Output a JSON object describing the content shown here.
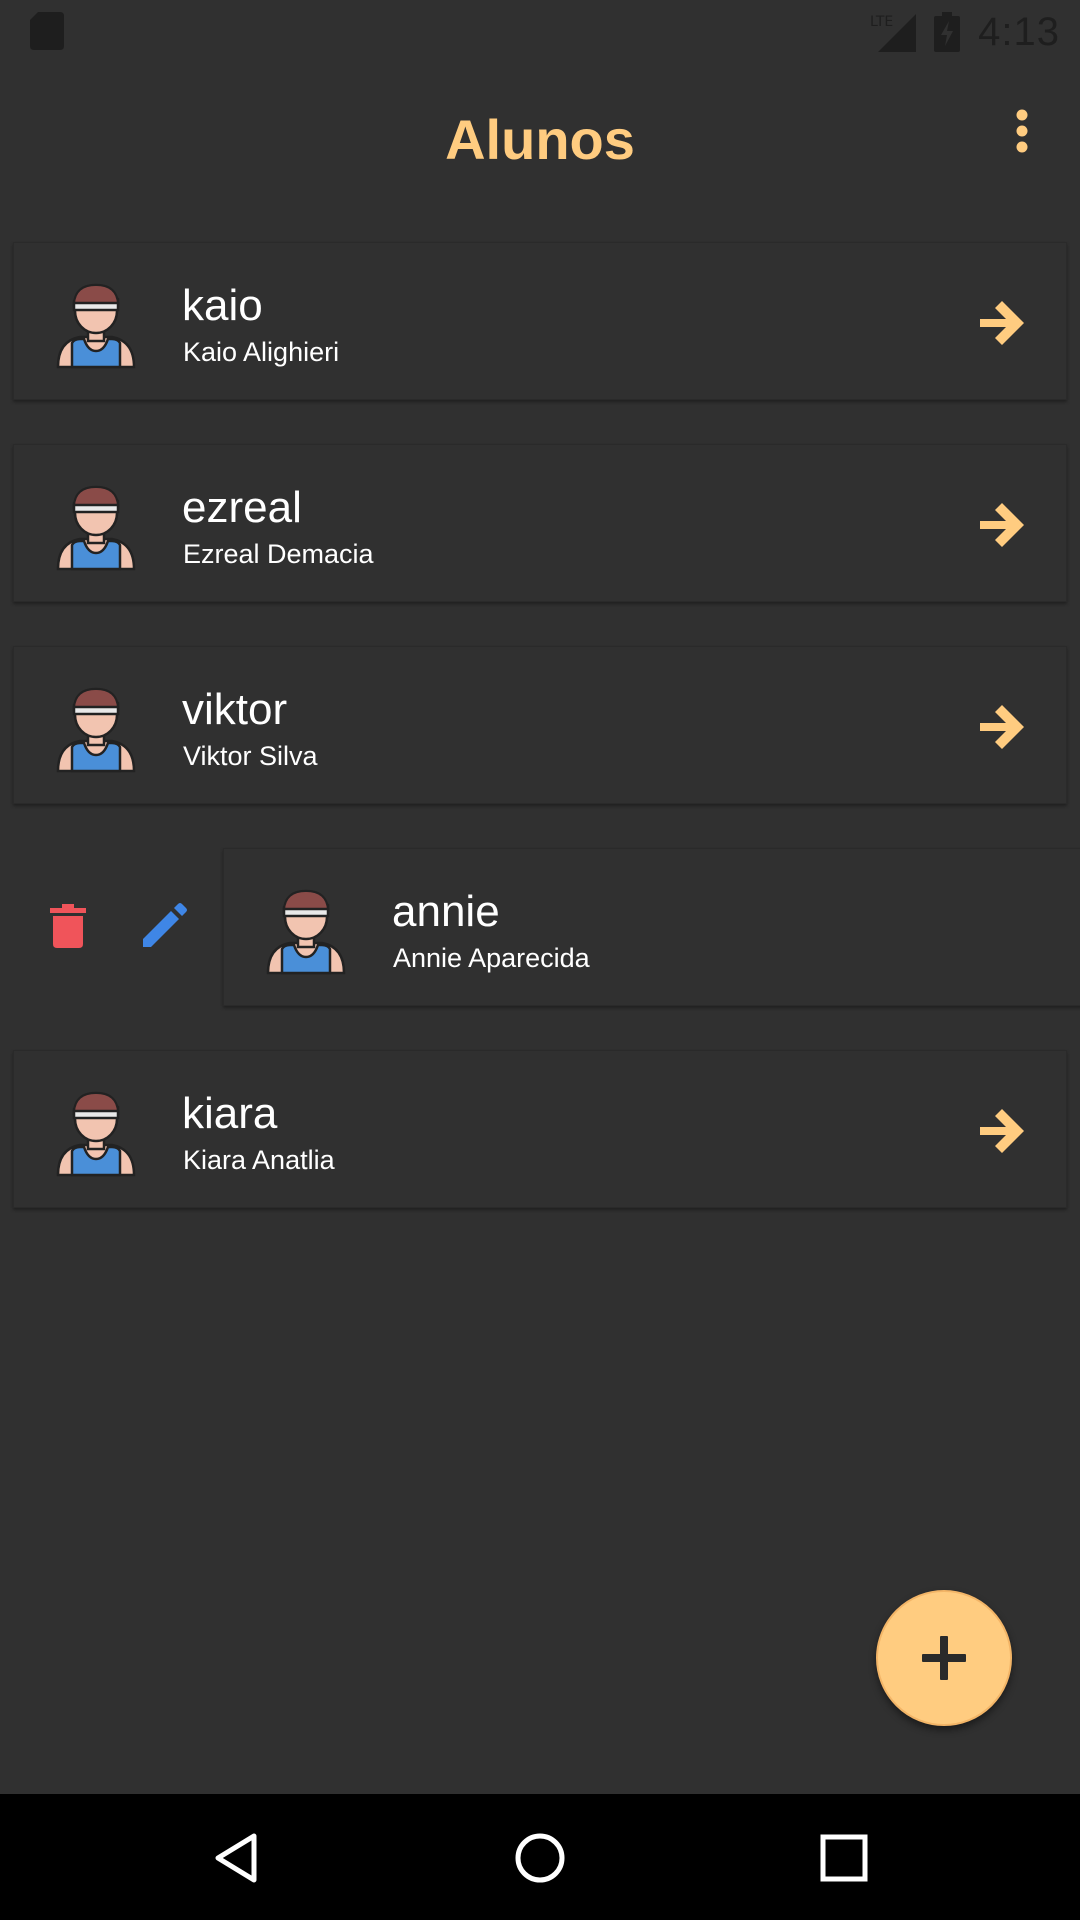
{
  "status_bar": {
    "network_label": "LTE",
    "time": "4:13",
    "icons": [
      "sd-card-icon",
      "signal-icon",
      "battery-charging-icon"
    ]
  },
  "app_bar": {
    "title": "Alunos",
    "menu_icon": "more-vert-icon"
  },
  "colors": {
    "background": "#303030",
    "accent": "#ffcc80",
    "delete": "#f0545a",
    "edit": "#3f86e6",
    "text": "#ffffff"
  },
  "students": [
    {
      "username": "kaio",
      "full_name": "Kaio Alighieri"
    },
    {
      "username": "ezreal",
      "full_name": "Ezreal Demacia"
    },
    {
      "username": "viktor",
      "full_name": "Viktor Silva"
    },
    {
      "username": "annie",
      "full_name": "Annie Aparecida",
      "swiped_open": true
    },
    {
      "username": "kiara",
      "full_name": "Kiara Anatlia"
    }
  ],
  "row_icons": {
    "avatar": "student-avatar-icon",
    "open": "arrow-right-icon",
    "delete": "trash-icon",
    "edit": "pencil-icon"
  },
  "fab": {
    "icon": "plus-icon"
  },
  "nav_bar": {
    "icons": [
      "back-triangle-icon",
      "home-circle-icon",
      "recents-square-icon"
    ]
  }
}
